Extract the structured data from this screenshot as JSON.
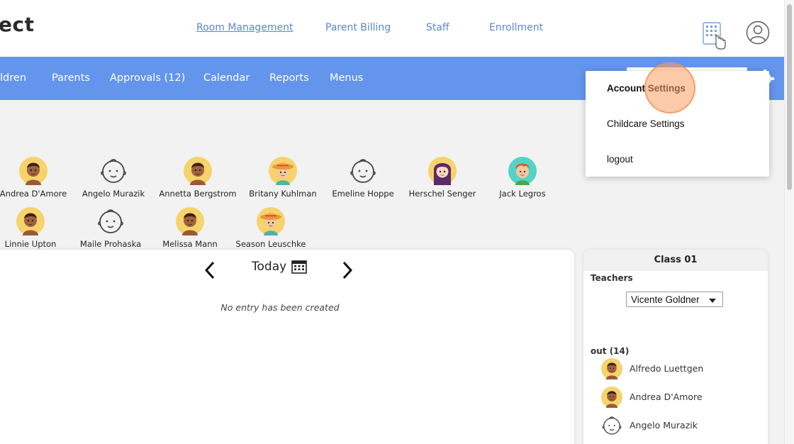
{
  "header": {
    "logo_fragment": "ect",
    "links": [
      "Room Management",
      "Parent Billing",
      "Staff",
      "Enrollment"
    ]
  },
  "nav": {
    "items": [
      "ildren",
      "Parents",
      "Approvals (12)",
      "Calendar",
      "Reports",
      "Menus"
    ]
  },
  "children": {
    "row1": [
      "Andrea D'Amore",
      "Angelo Murazik",
      "Annetta Bergstrom",
      "Britany Kuhlman",
      "Emeline Hoppe",
      "Herschel Senger",
      "Jack Legros"
    ],
    "row2": [
      "Linnie Upton",
      "Maile Prohaska",
      "Melissa Mann",
      "Season Leuschke"
    ]
  },
  "calendar": {
    "date_label": "Today",
    "empty_message": "No entry has been created"
  },
  "class_panel": {
    "title": "Class 01",
    "teachers_label": "Teachers",
    "selected_teacher": "Vicente Goldner",
    "out_label": "out (14)",
    "out_children": [
      "Alfredo Luettgen",
      "Andrea D'Amore",
      "Angelo Murazik"
    ]
  },
  "account_menu": {
    "items": [
      "Account Settings",
      "Childcare Settings",
      "logout"
    ]
  },
  "colors": {
    "nav_blue": "#6495ed",
    "link_blue": "#5a86d6",
    "click_highlight": "#fda064"
  },
  "icons": {
    "keypad": "keypad-touch-icon",
    "user": "user-circle-icon",
    "gear": "gear-icon",
    "calendar": "calendar-icon",
    "prev": "chevron-left-icon",
    "next": "chevron-right-icon"
  }
}
